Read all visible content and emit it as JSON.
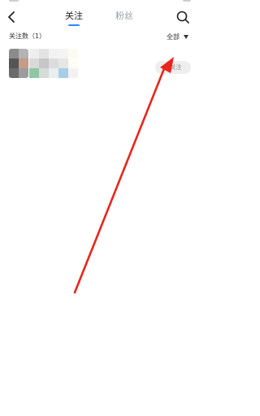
{
  "header": {
    "tabs": [
      {
        "label": "关注",
        "active": true
      },
      {
        "label": "粉丝",
        "active": false
      }
    ],
    "icons": {
      "back": "chevron-left-icon",
      "search": "search-icon"
    }
  },
  "list": {
    "count_label": "关注数（1）",
    "filter_label": "全部"
  },
  "users": [
    {
      "status_label": "已关注"
    }
  ],
  "colors": {
    "accent": "#2e86ff",
    "annotation": "#e8251c"
  }
}
